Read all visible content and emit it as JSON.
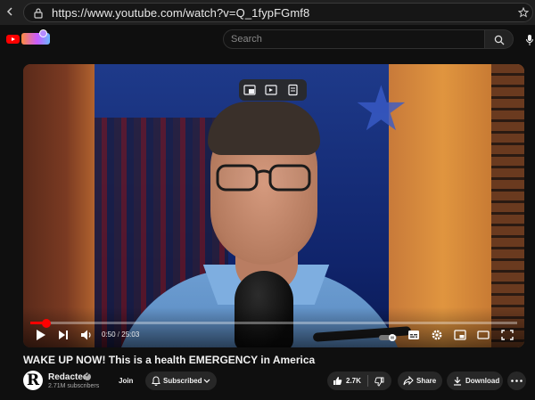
{
  "browser": {
    "url": "https://www.youtube.com/watch?v=Q_1fypFGmf8"
  },
  "header": {
    "search_placeholder": "Search",
    "logo_icon": "youtube-logo-icon"
  },
  "player": {
    "progress": 0.033,
    "current_time": "0:50",
    "separator": " / ",
    "duration": "25:03",
    "overlay_icons": [
      "pip-icon",
      "play-later-icon",
      "notes-icon"
    ],
    "controls": [
      "play-icon",
      "next-icon",
      "volume-icon",
      "autoplay-toggle",
      "subtitles-icon",
      "settings-icon",
      "miniplayer-icon",
      "theater-icon",
      "fullscreen-icon"
    ]
  },
  "video": {
    "title": "WAKE UP NOW! This is a health EMERGENCY in America"
  },
  "channel": {
    "avatar_letter": "R",
    "name": "Redacted",
    "subscribers": "2.71M subscribers"
  },
  "actions": {
    "join_label": "Join",
    "subscribed_label": "Subscribed",
    "like_count": "2.7K",
    "share_label": "Share",
    "download_label": "Download"
  },
  "colors": {
    "accent": "#ff0000",
    "background": "#0f0f0f",
    "button": "#272727"
  }
}
